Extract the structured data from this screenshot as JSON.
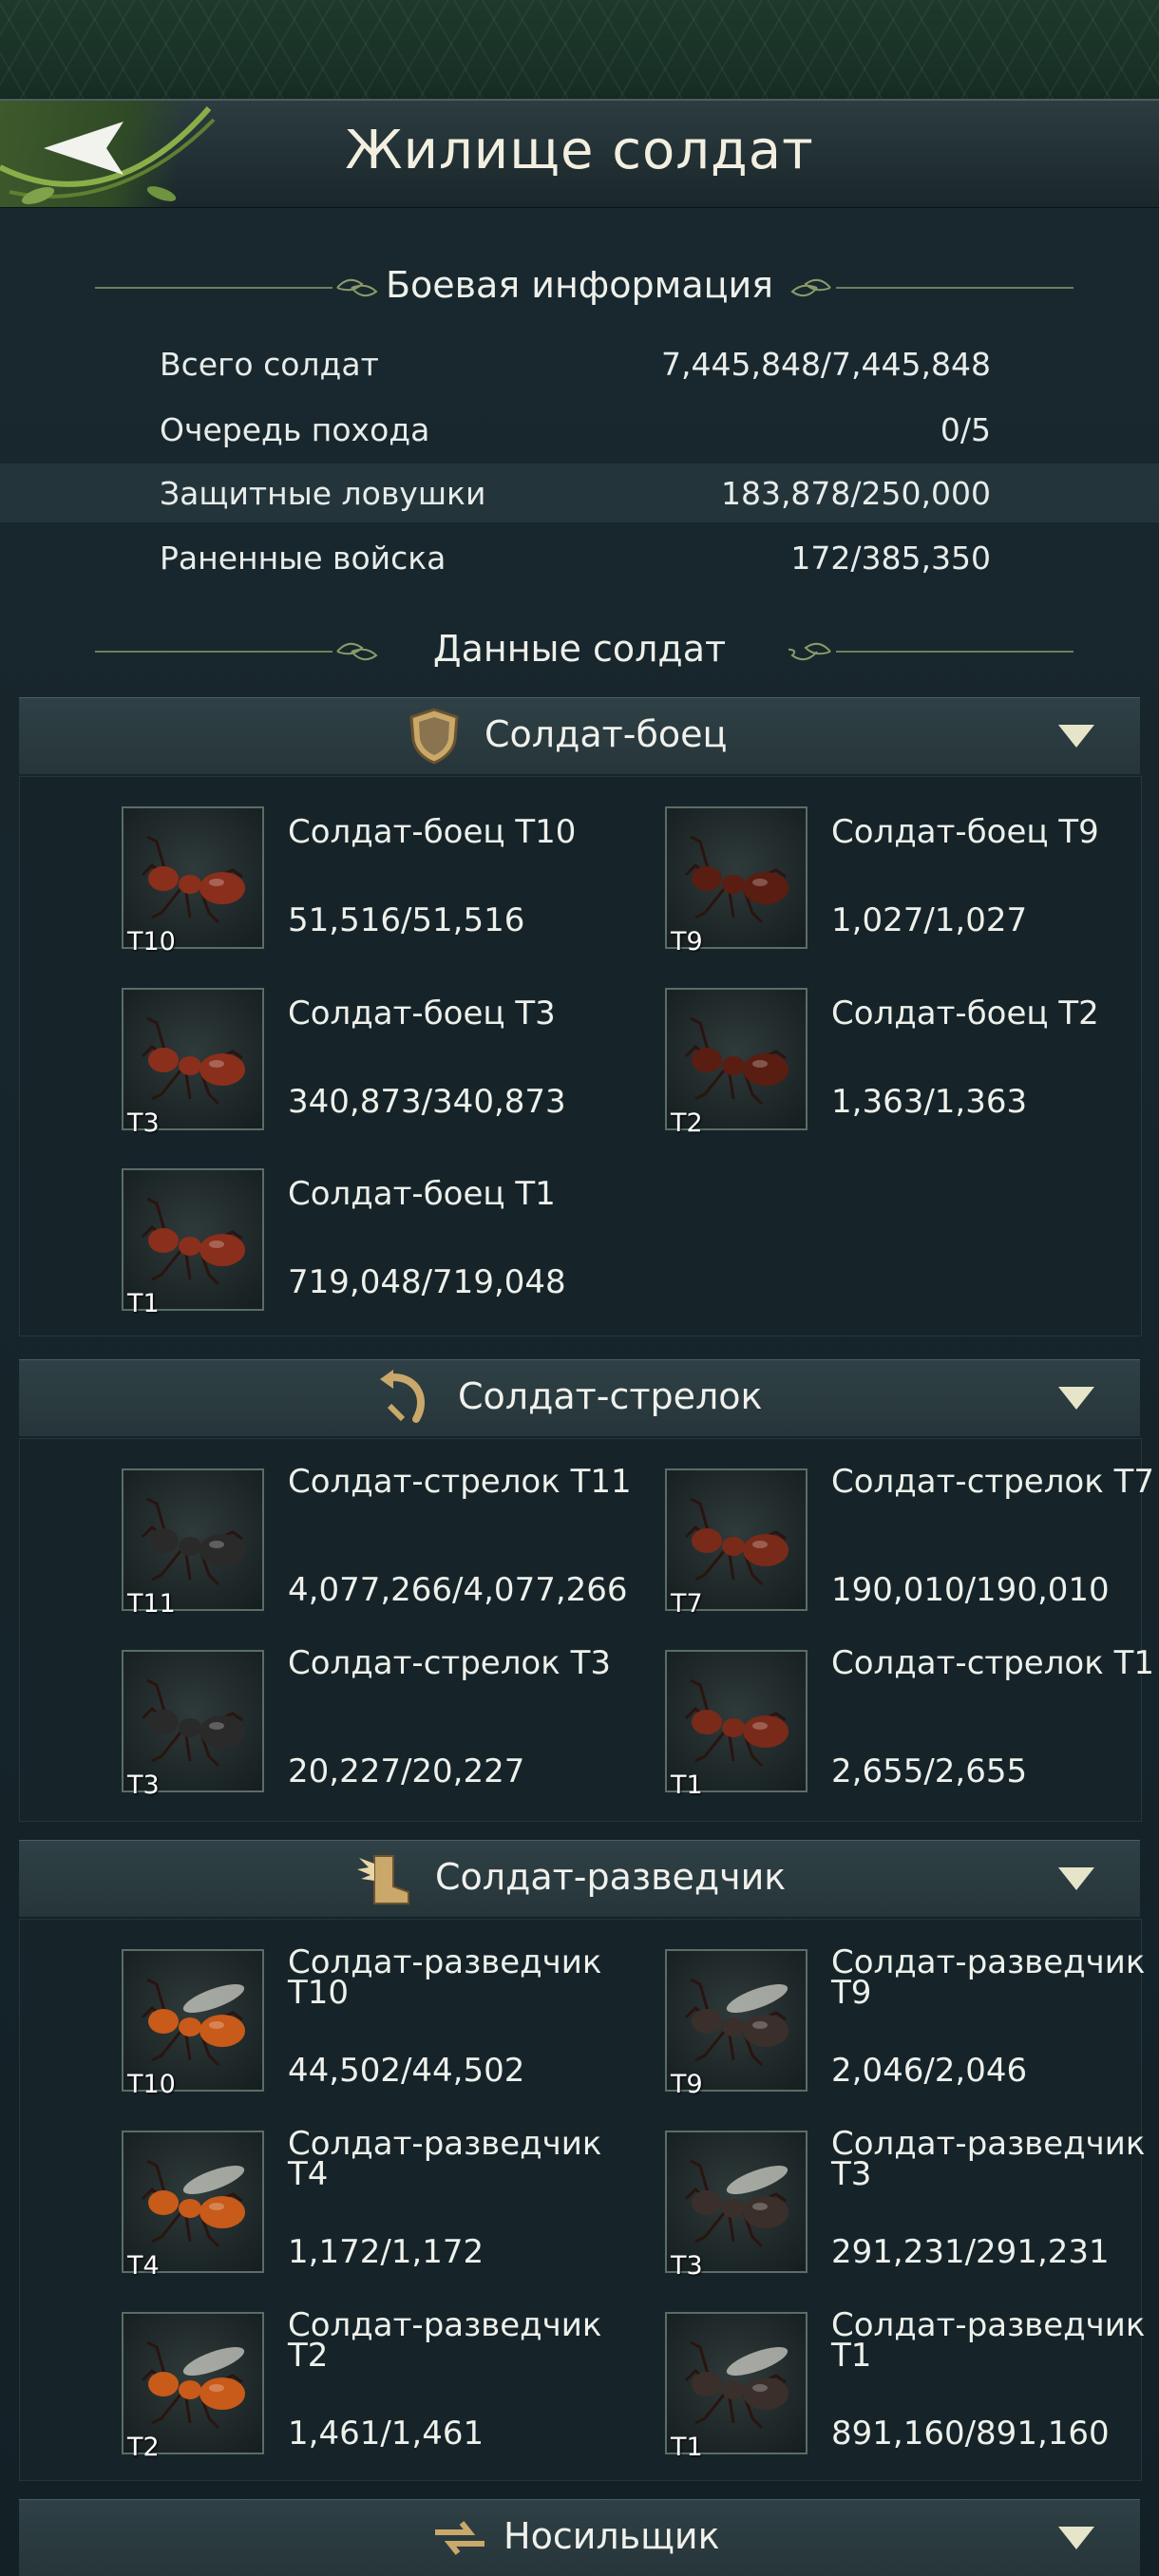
{
  "header": {
    "title": "Жилище солдат",
    "back_icon": "back-arrow-icon"
  },
  "battle_info": {
    "title": "Боевая информация",
    "rows": [
      {
        "label": "Всего солдат",
        "value": "7,445,848/7,445,848"
      },
      {
        "label": "Очередь похода",
        "value": "0/5"
      },
      {
        "label": "Защитные ловушки",
        "value": "183,878/250,000"
      },
      {
        "label": "Раненные войска",
        "value": "172/385,350"
      }
    ]
  },
  "soldier_data_title": "Данные солдат",
  "categories": [
    {
      "label": "Солдат-боец",
      "icon": "shield-icon",
      "units": [
        {
          "name": "Солдат-боец T10",
          "count": "51,516/51,516",
          "tier": "T10"
        },
        {
          "name": "Солдат-боец T9",
          "count": "1,027/1,027",
          "tier": "T9"
        },
        {
          "name": "Солдат-боец T3",
          "count": "340,873/340,873",
          "tier": "T3"
        },
        {
          "name": "Солдат-боец T2",
          "count": "1,363/1,363",
          "tier": "T2"
        },
        {
          "name": "Солдат-боец T1",
          "count": "719,048/719,048",
          "tier": "T1"
        }
      ]
    },
    {
      "label": "Солдат-стрелок",
      "icon": "bow-icon",
      "units": [
        {
          "name": "Солдат-стрелок T11",
          "count": "4,077,266/4,077,266",
          "tier": "T11"
        },
        {
          "name": "Солдат-стрелок T7",
          "count": "190,010/190,010",
          "tier": "T7"
        },
        {
          "name": "Солдат-стрелок T3",
          "count": "20,227/20,227",
          "tier": "T3"
        },
        {
          "name": "Солдат-стрелок T1",
          "count": "2,655/2,655",
          "tier": "T1"
        }
      ]
    },
    {
      "label": "Солдат-разведчик",
      "icon": "winged-boot-icon",
      "units": [
        {
          "name": "Солдат-разведчик T10",
          "count": "44,502/44,502",
          "tier": "T10"
        },
        {
          "name": "Солдат-разведчик T9",
          "count": "2,046/2,046",
          "tier": "T9"
        },
        {
          "name": "Солдат-разведчик T4",
          "count": "1,172/1,172",
          "tier": "T4"
        },
        {
          "name": "Солдат-разведчик T3",
          "count": "291,231/291,231",
          "tier": "T3"
        },
        {
          "name": "Солдат-разведчик T2",
          "count": "1,461/1,461",
          "tier": "T2"
        },
        {
          "name": "Солдат-разведчик T1",
          "count": "891,160/891,160",
          "tier": "T1"
        }
      ]
    },
    {
      "label": "Носильщик",
      "icon": "carrier-arrows-icon",
      "units": []
    }
  ],
  "colors": {
    "background": "#14242a",
    "header": "#2c3c40",
    "accent_leaf": "#7fa24a",
    "chevron": "#e6e4c9"
  }
}
